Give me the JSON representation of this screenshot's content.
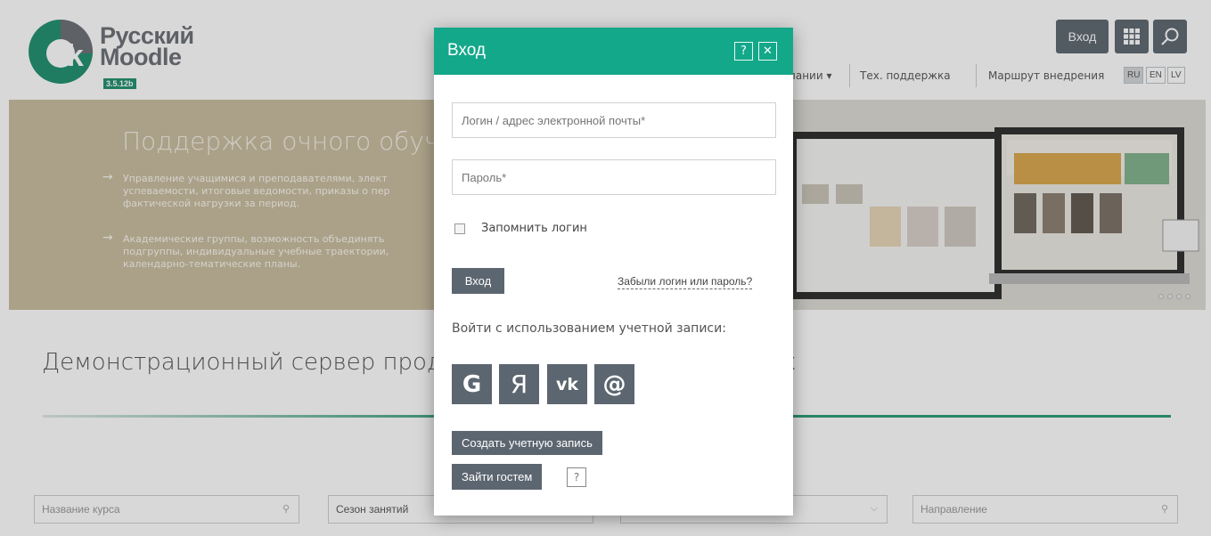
{
  "header": {
    "logo_text_line1": "Русский",
    "logo_text_line2": "Moodle",
    "logo_version": "3.5.12b",
    "login_button": "Вход",
    "apps_icon": "grid-icon",
    "search_icon": "search-icon",
    "nav": {
      "company": "пании ▾",
      "support": "Тех. поддержка",
      "route": "Маршрут внедрения"
    },
    "languages": [
      "RU",
      "EN",
      "LV"
    ]
  },
  "slider": {
    "title": "Поддержка очного обуч",
    "items": [
      "Управление учащимися и преподавателями, элект\nуспеваемости, итоговые ведомости, приказы о пер\nфактической нагрузки за период.",
      "Академические группы, возможность объединять\nподгруппы, индивидуальные учебные траектории,\nкалендарно-тематические планы."
    ],
    "arrow": "→"
  },
  "main": {
    "demo_title": "Демонстрационный сервер продукт",
    "demo_title_tail": "х"
  },
  "filters": {
    "course_placeholder": "Название курса",
    "season": "Сезон занятий",
    "direction_placeholder": "Направление",
    "search_icon": "search-icon",
    "chevron_icon": "chevron-down-icon"
  },
  "modal": {
    "title": "Вход",
    "help_label": "?",
    "close_label": "✕",
    "login_placeholder": "Логин / адрес электронной почты*",
    "password_placeholder": "Пароль*",
    "remember_label": "Запомнить логин",
    "login_button": "Вход",
    "forgot_link": "Забыли логин или пароль?",
    "social_label": "Войти с использованием учетной записи:",
    "social": {
      "google": "G",
      "yandex": "Я",
      "vk": "vk",
      "mail": "@"
    },
    "create_account": "Создать учетную запись",
    "guest_login": "Зайти гостем",
    "guest_help": "?"
  },
  "colors": {
    "accent": "#14a88a",
    "button": "#5c6670",
    "slider_bg": "#c9bc9e"
  }
}
